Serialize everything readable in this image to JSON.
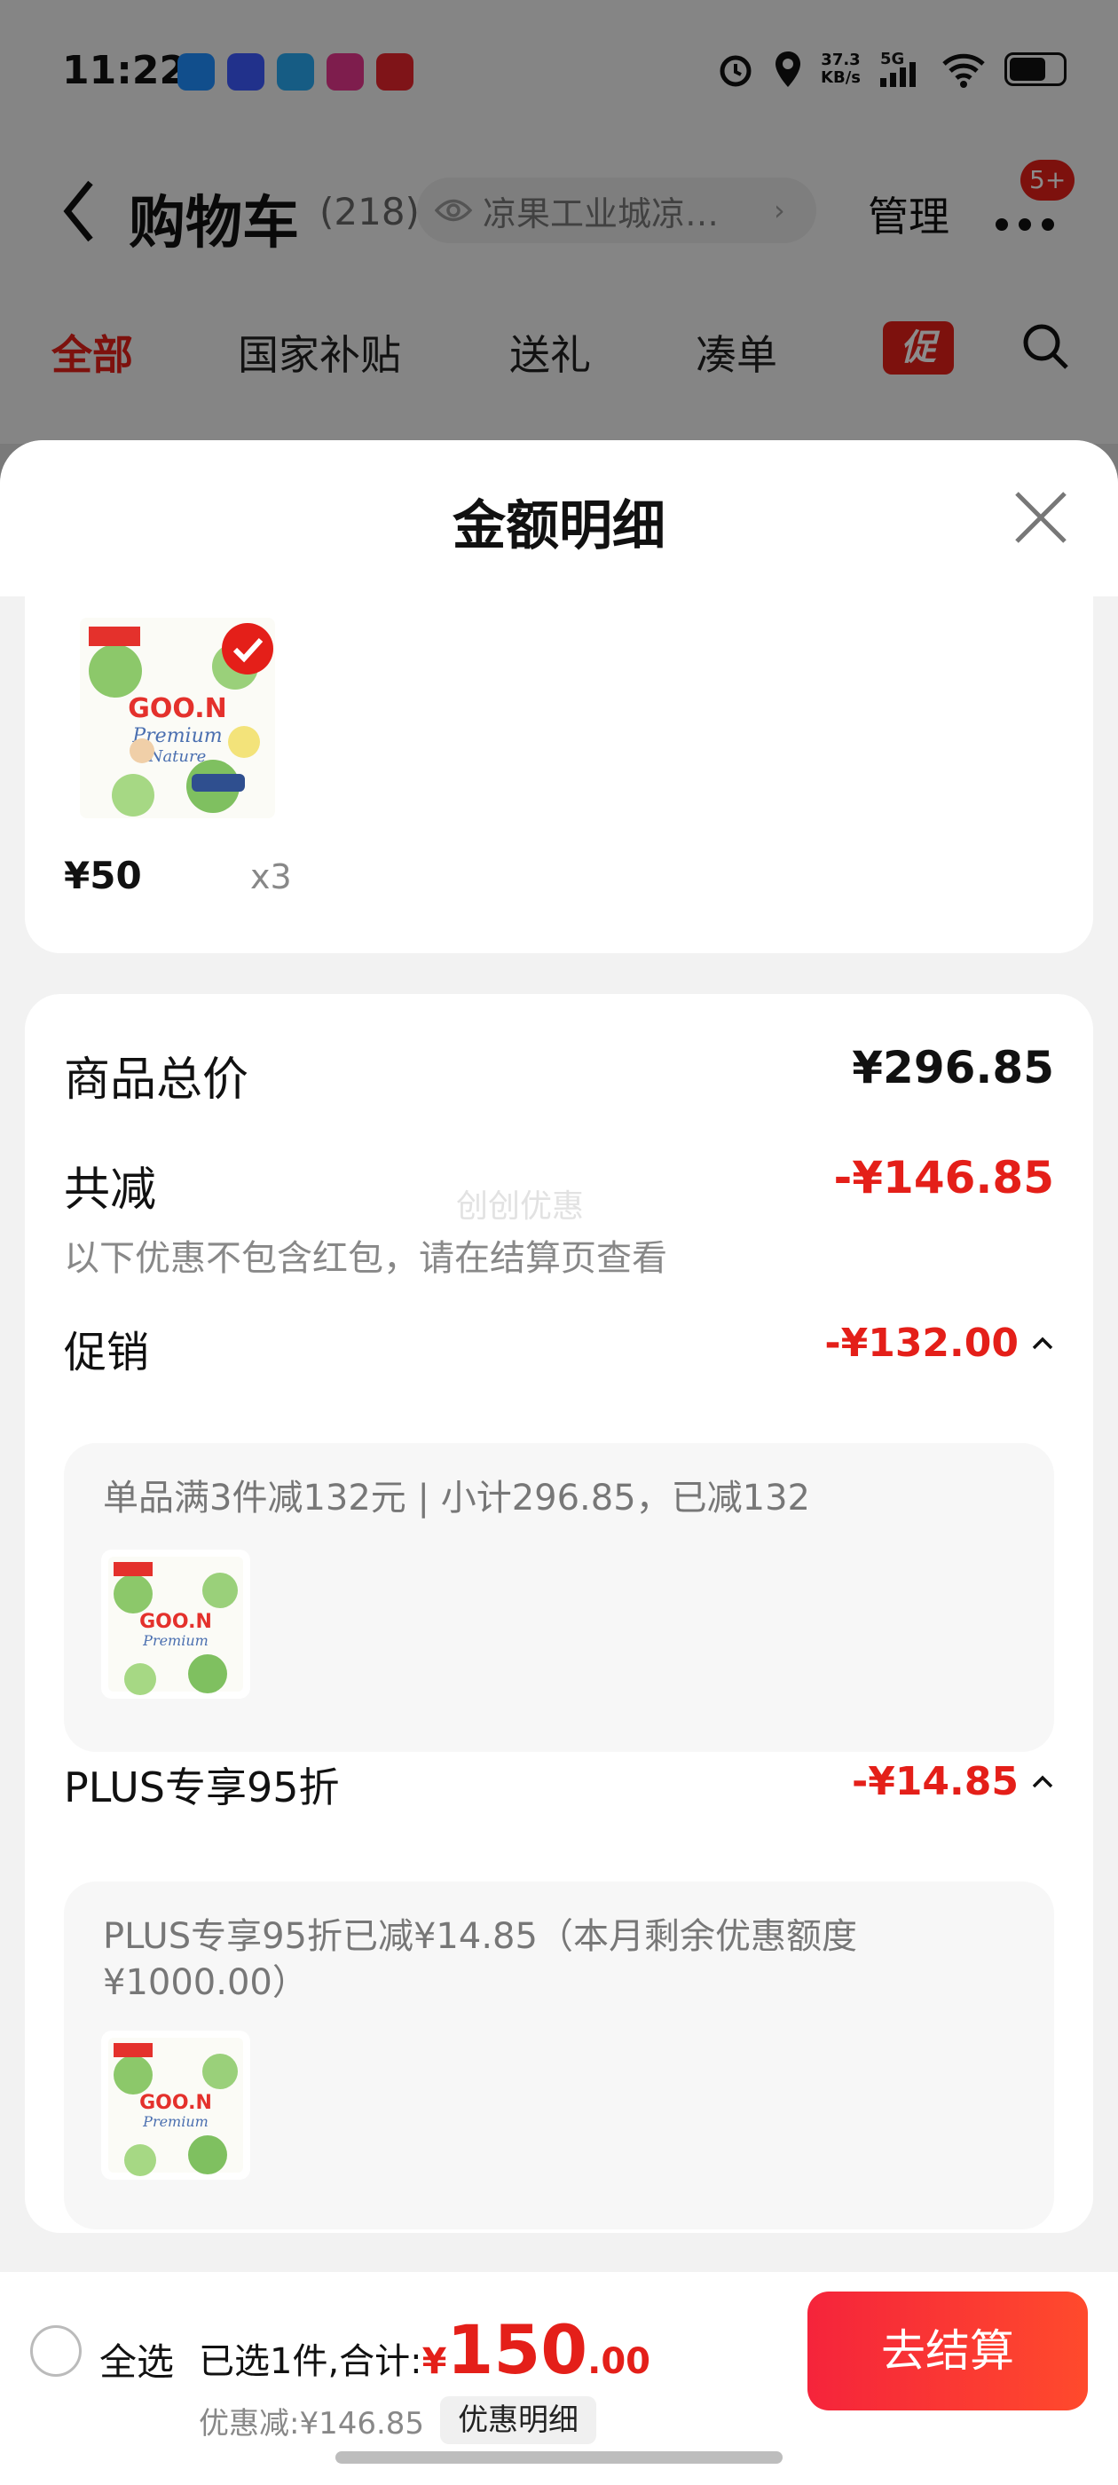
{
  "status_bar": {
    "time": "11:22",
    "net_speed_value": "37.3",
    "net_speed_unit": "KB/s",
    "network": "5G"
  },
  "nav": {
    "title": "购物车",
    "count": "(218)",
    "address": "凉果工业城凉…",
    "manage": "管理",
    "badge": "5+"
  },
  "tabs": [
    "全部",
    "国家补贴",
    "送礼",
    "凑单"
  ],
  "promo_tab": "促",
  "sheet": {
    "title": "金额明细",
    "product": {
      "price": "¥50",
      "qty": "x3"
    },
    "summary": {
      "total_label": "商品总价",
      "total_value": "¥296.85",
      "discount_label": "共减",
      "discount_value": "-¥146.85",
      "discount_note": "以下优惠不包含红包，请在结算页查看",
      "watermark": "创创优惠"
    },
    "promotion": {
      "label": "促销",
      "value": "-¥132.00",
      "desc": "单品满3件减132元 | 小计296.85，已减132"
    },
    "plus": {
      "label": "PLUS专享95折",
      "value": "-¥14.85",
      "desc": "PLUS专享95折已减¥14.85（本月剩余优惠额度¥1000.00）"
    }
  },
  "checkout": {
    "select_all": "全选",
    "selected_text": "已选1件,合计:",
    "total_yen": "¥",
    "total_int": "150",
    "total_dec": ".00",
    "saved": "优惠减:¥146.85",
    "detail_chip": "优惠明细",
    "button": "去结算"
  },
  "colors": {
    "accent_red": "#e41f19",
    "sheet_bg": "#f2f2f2",
    "card_bg": "#ffffff"
  }
}
